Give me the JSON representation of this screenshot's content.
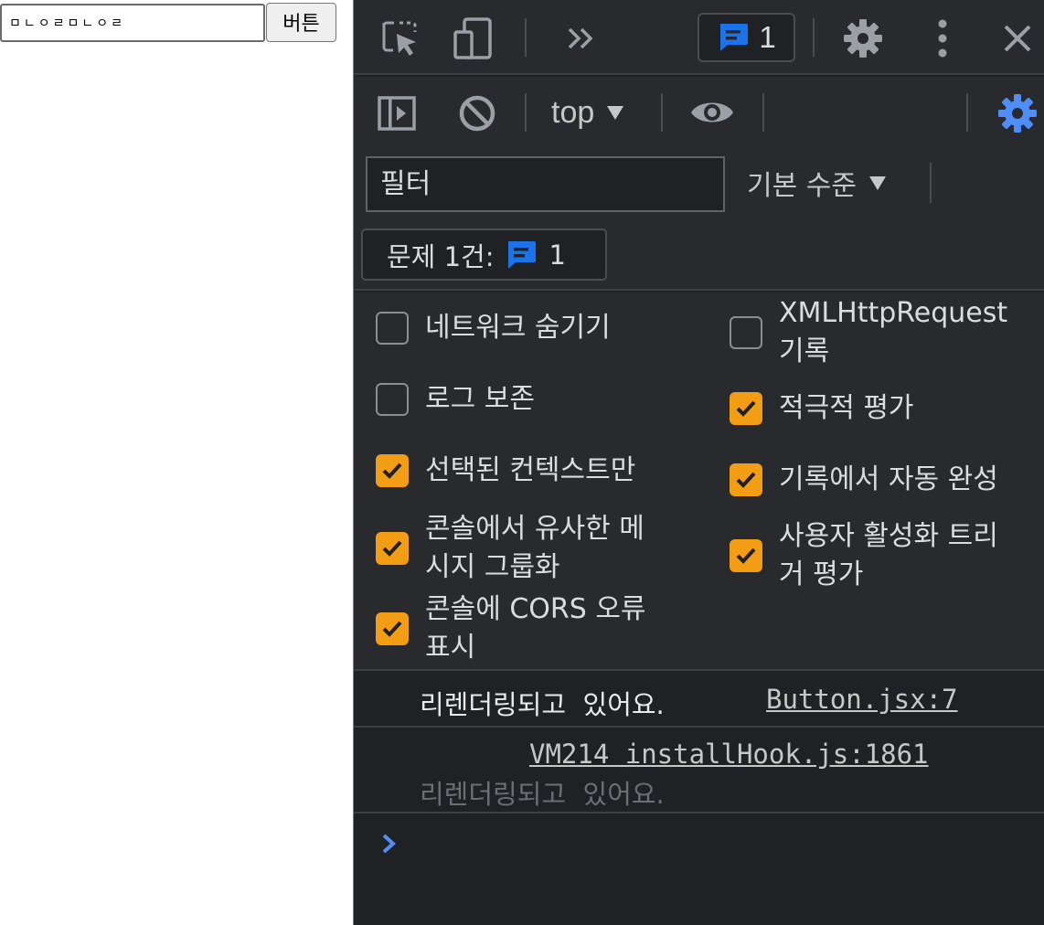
{
  "page": {
    "input_value": "ㅁㄴㅇㄹㅁㄴㅇㄹ",
    "button_label": "버튼"
  },
  "devtools": {
    "topbar": {
      "issues_badge_count": "1"
    },
    "toolbar": {
      "context_label": "top"
    },
    "filter": {
      "placeholder": "필터",
      "level_label": "기본 수준"
    },
    "issues": {
      "label": "문제 1건:",
      "count": "1"
    },
    "settings": {
      "left": [
        {
          "label": "네트워크 숨기기",
          "checked": false
        },
        {
          "label": "로그 보존",
          "checked": false
        },
        {
          "label": "선택된 컨텍스트만",
          "checked": true
        },
        {
          "label": "콘솔에서 유사한 메\n시지 그룹화",
          "checked": true
        },
        {
          "label": "콘솔에 CORS 오류\n표시",
          "checked": true
        }
      ],
      "right": [
        {
          "label": "XMLHttpRequest\n기록",
          "checked": false
        },
        {
          "label": "적극적 평가",
          "checked": true
        },
        {
          "label": "기록에서 자동 완성",
          "checked": true
        },
        {
          "label": "사용자 활성화 트리\n거 평가",
          "checked": true
        }
      ]
    },
    "console": {
      "messages": [
        {
          "text": "리렌더링되고  있어요.",
          "source": "Button.jsx:7"
        },
        {
          "text": "리렌더링되고  있어요.",
          "source": "VM214 installHook.js:1861"
        }
      ]
    },
    "colors": {
      "accent_blue": "#1a73e8",
      "checkbox_orange": "#f29d13",
      "settings_gear_blue": "#4f8ef7"
    }
  }
}
